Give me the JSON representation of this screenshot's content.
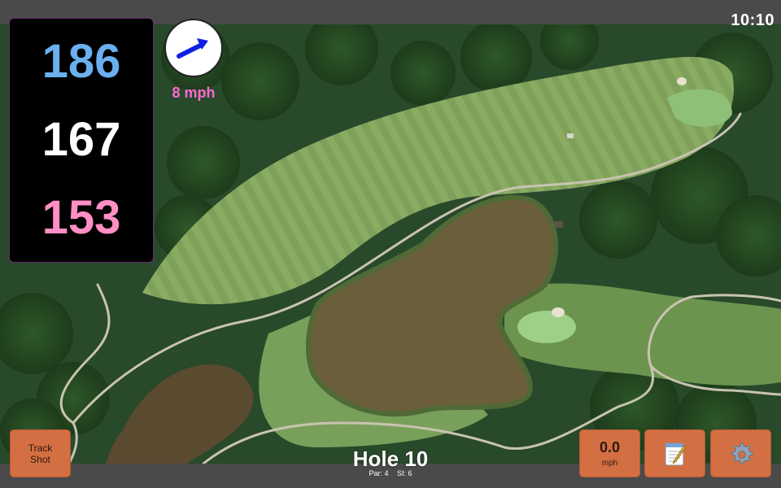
{
  "status": {
    "clock": "10:10"
  },
  "yardages": {
    "back": "186",
    "middle": "167",
    "front": "153"
  },
  "wind": {
    "speed": "8 mph",
    "arrow_icon": "wind-direction-arrow-icon",
    "arrow_color": "#1020e0"
  },
  "hole": {
    "title": "Hole 10",
    "par": "Par: 4",
    "si": "SI: 6"
  },
  "buttons": {
    "track_shot": {
      "line1": "Track",
      "line2": "Shot"
    },
    "speed": {
      "value": "0.0",
      "unit": "mph"
    },
    "notes_icon": "notepad-icon",
    "settings_icon": "gear-icon"
  },
  "colors": {
    "back_yardage": "#6ab0f0",
    "middle_yardage": "#ffffff",
    "front_yardage": "#ff8fc4",
    "wind_text": "#ff6ad0",
    "button_bg": "#d36f42"
  }
}
